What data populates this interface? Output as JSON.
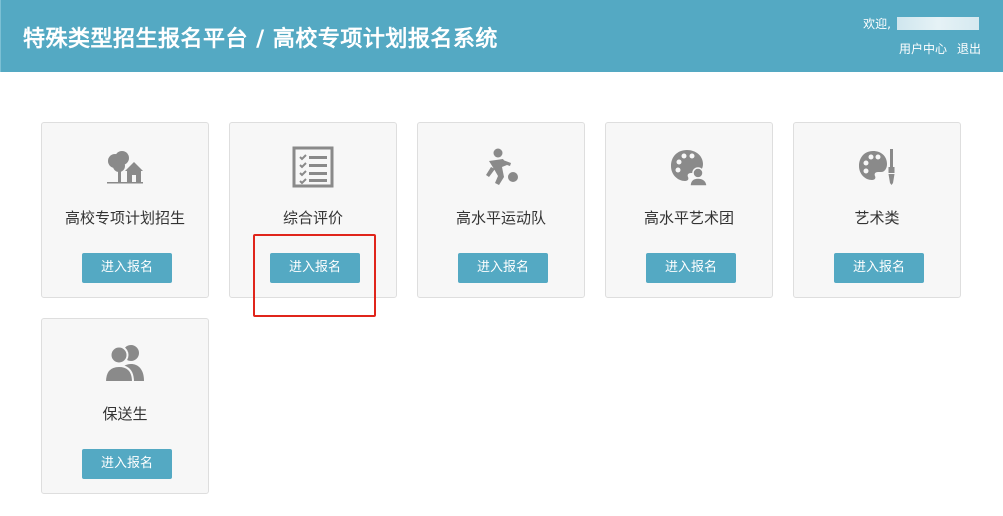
{
  "header": {
    "title": "特殊类型招生报名平台 / 高校专项计划报名系统",
    "welcome_label": "欢迎,",
    "user_center": "用户中心",
    "logout": "退出"
  },
  "colors": {
    "accent": "#54a9c3",
    "card_bg": "#f7f7f7",
    "highlight": "#e0251b",
    "icon": "#8a8a8a"
  },
  "cards": [
    {
      "label": "高校专项计划招生",
      "button": "进入报名",
      "icon": "tree-house-icon"
    },
    {
      "label": "综合评价",
      "button": "进入报名",
      "icon": "checklist-icon"
    },
    {
      "label": "高水平运动队",
      "button": "进入报名",
      "icon": "soccer-player-icon"
    },
    {
      "label": "高水平艺术团",
      "button": "进入报名",
      "icon": "palette-person-icon"
    },
    {
      "label": "艺术类",
      "button": "进入报名",
      "icon": "palette-brush-icon"
    },
    {
      "label": "保送生",
      "button": "进入报名",
      "icon": "users-icon"
    }
  ]
}
